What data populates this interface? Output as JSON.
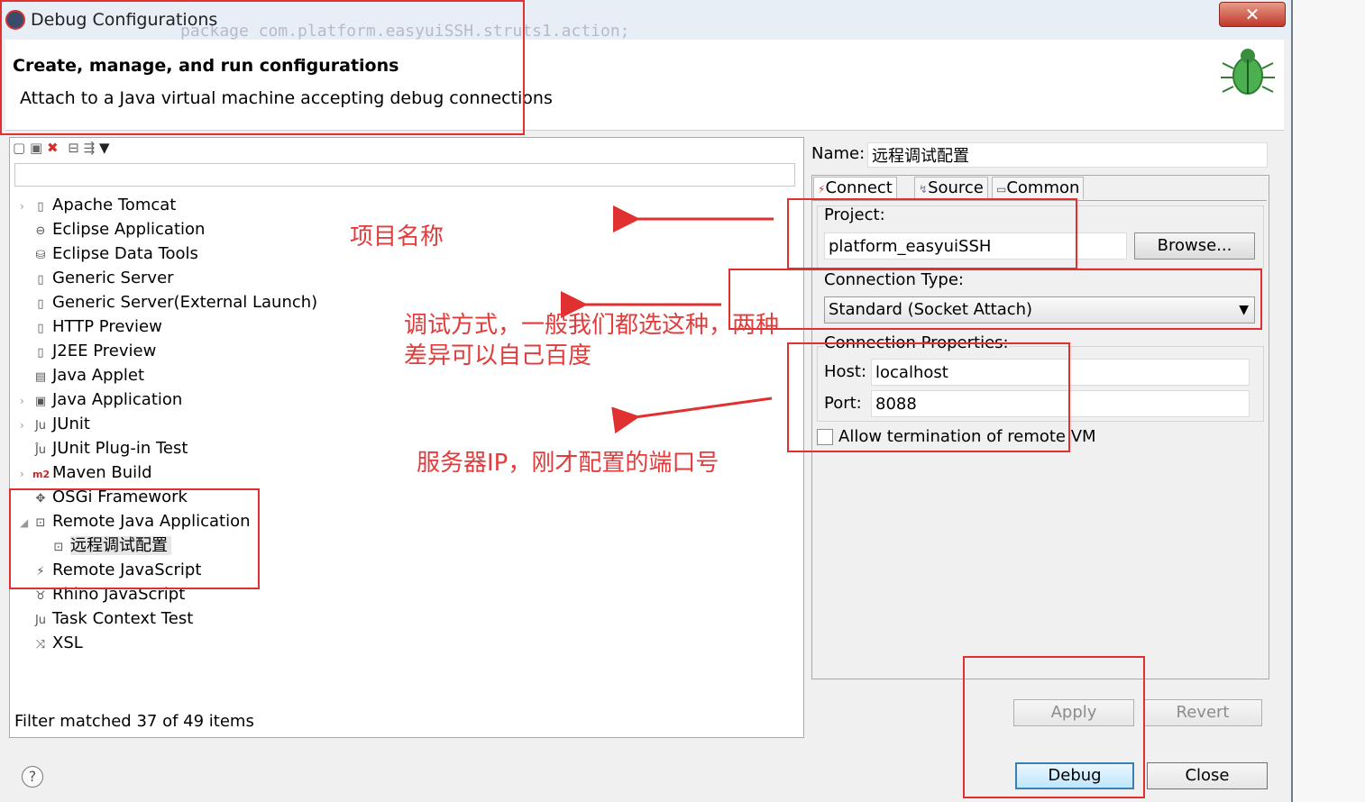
{
  "window": {
    "title": "Debug Configurations",
    "close_glyph": "✕",
    "background_code": "package com.platform.easyuiSSH.struts1.action;"
  },
  "banner": {
    "title": "Create, manage, and run configurations",
    "subtitle": "Attach to a Java virtual machine accepting debug connections",
    "icon": "bug-icon"
  },
  "left": {
    "filter_value": "",
    "tree": [
      {
        "label": "Apache Tomcat",
        "expander": "›",
        "icon": "server-icon"
      },
      {
        "label": "Eclipse Application",
        "expander": "",
        "icon": "eclipse-icon"
      },
      {
        "label": "Eclipse Data Tools",
        "expander": "",
        "icon": "database-icon"
      },
      {
        "label": "Generic Server",
        "expander": "",
        "icon": "server-icon"
      },
      {
        "label": "Generic Server(External Launch)",
        "expander": "",
        "icon": "server-icon"
      },
      {
        "label": "HTTP Preview",
        "expander": "",
        "icon": "server-icon"
      },
      {
        "label": "J2EE Preview",
        "expander": "",
        "icon": "server-icon"
      },
      {
        "label": "Java Applet",
        "expander": "",
        "icon": "applet-icon"
      },
      {
        "label": "Java Application",
        "expander": "›",
        "icon": "java-app-icon"
      },
      {
        "label": "JUnit",
        "expander": "›",
        "icon": "junit-icon"
      },
      {
        "label": "JUnit Plug-in Test",
        "expander": "",
        "icon": "junit-plugin-icon"
      },
      {
        "label": "Maven Build",
        "expander": "›",
        "icon": "maven-icon"
      },
      {
        "label": "OSGi Framework",
        "expander": "",
        "icon": "osgi-icon"
      },
      {
        "label": "Remote Java Application",
        "expander": "◢",
        "icon": "remote-java-icon"
      },
      {
        "label": "远程调试配置",
        "expander": "",
        "icon": "remote-java-icon",
        "child": true,
        "selected": true
      },
      {
        "label": "Remote JavaScript",
        "expander": "",
        "icon": "remote-js-icon"
      },
      {
        "label": "Rhino JavaScript",
        "expander": "",
        "icon": "rhino-icon"
      },
      {
        "label": "Task Context Test",
        "expander": "",
        "icon": "task-test-icon"
      },
      {
        "label": "XSL",
        "expander": "",
        "icon": "xsl-icon"
      }
    ],
    "status": "Filter matched 37 of 49 items"
  },
  "right": {
    "name_label": "Name:",
    "name_value": "远程调试配置",
    "tabs": [
      {
        "label": "Connect",
        "icon": "connect-icon"
      },
      {
        "label": "Source",
        "icon": "source-icon"
      },
      {
        "label": "Common",
        "icon": "common-icon"
      }
    ],
    "project_label": "Project:",
    "project_value": "platform_easyuiSSH",
    "browse_label": "Browse...",
    "connection_type_label": "Connection Type:",
    "connection_type_value": "Standard (Socket Attach)",
    "connection_properties_label": "Connection Properties:",
    "host_label": "Host:",
    "host_value": "localhost",
    "port_label": "Port:",
    "port_value": "8088",
    "allow_termination_label": "Allow termination of remote VM",
    "allow_termination_checked": false
  },
  "buttons": {
    "apply": "Apply",
    "revert": "Revert",
    "debug": "Debug",
    "close": "Close",
    "help": "?"
  },
  "annotations": {
    "color": "#e03030",
    "project_note": "项目名称",
    "connection_note_line1": "调试方式，一般我们都选这种，两种",
    "connection_note_line2": "差异可以自己百度",
    "host_note": "服务器IP，刚才配置的端口号"
  }
}
